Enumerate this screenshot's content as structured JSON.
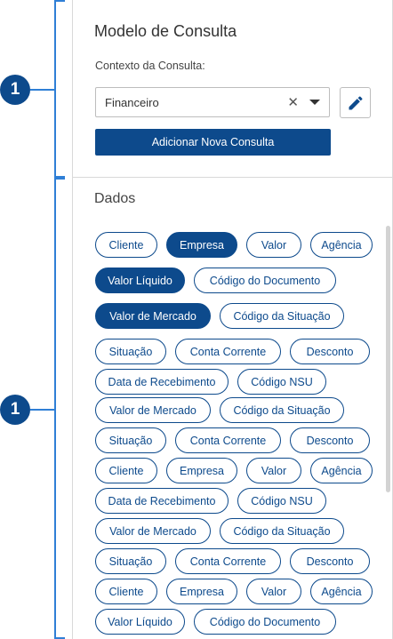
{
  "annotations": [
    {
      "label": "1"
    },
    {
      "label": "1"
    }
  ],
  "model": {
    "title": "Modelo de Consulta",
    "context_label": "Contexto da Consulta:",
    "context_value": "Financeiro",
    "clear_icon": "close-icon",
    "caret_icon": "chevron-down-icon",
    "edit_icon": "pencil-icon",
    "add_button": "Adicionar Nova Consulta"
  },
  "data": {
    "title": "Dados",
    "rows": [
      [
        {
          "label": "Cliente",
          "active": false
        },
        {
          "label": "Empresa",
          "active": true
        },
        {
          "label": "Valor",
          "active": false
        },
        {
          "label": "Agência",
          "active": false
        }
      ],
      [
        {
          "label": "Valor Líquido",
          "active": true
        },
        {
          "label": "Código do Documento",
          "active": false
        }
      ],
      [
        {
          "label": "Valor de Mercado",
          "active": true
        },
        {
          "label": "Código da Situação",
          "active": false
        }
      ],
      [
        {
          "label": "Situação",
          "active": false
        },
        {
          "label": "Conta Corrente",
          "active": false
        },
        {
          "label": "Desconto",
          "active": false
        }
      ],
      [
        {
          "label": "Data de Recebimento",
          "active": false
        },
        {
          "label": "Código NSU",
          "active": false
        }
      ],
      [
        {
          "label": "Valor de Mercado",
          "active": false
        },
        {
          "label": "Código da Situação",
          "active": false
        }
      ],
      [
        {
          "label": "Situação",
          "active": false
        },
        {
          "label": "Conta Corrente",
          "active": false
        },
        {
          "label": "Desconto",
          "active": false
        }
      ],
      [
        {
          "label": "Cliente",
          "active": false
        },
        {
          "label": "Empresa",
          "active": false
        },
        {
          "label": "Valor",
          "active": false
        },
        {
          "label": "Agência",
          "active": false
        }
      ],
      [
        {
          "label": "Data de Recebimento",
          "active": false
        },
        {
          "label": "Código NSU",
          "active": false
        }
      ],
      [
        {
          "label": "Valor de Mercado",
          "active": false
        },
        {
          "label": "Código da Situação",
          "active": false
        }
      ],
      [
        {
          "label": "Situação",
          "active": false
        },
        {
          "label": "Conta Corrente",
          "active": false
        },
        {
          "label": "Desconto",
          "active": false
        }
      ],
      [
        {
          "label": "Cliente",
          "active": false
        },
        {
          "label": "Empresa",
          "active": false
        },
        {
          "label": "Valor",
          "active": false
        },
        {
          "label": "Agência",
          "active": false
        }
      ],
      [
        {
          "label": "Valor Líquido",
          "active": false
        },
        {
          "label": "Código do Documento",
          "active": false
        }
      ]
    ]
  },
  "colors": {
    "primary": "#0d4a8c",
    "annotation_line": "#2f7fd6",
    "border": "#d9d9d9"
  }
}
